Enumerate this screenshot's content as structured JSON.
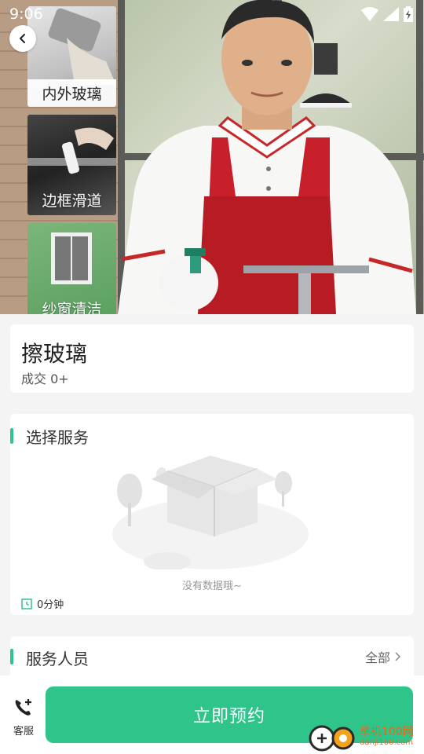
{
  "status_bar": {
    "time": "9:06"
  },
  "hero": {
    "thumbnails": [
      {
        "label": "内外玻璃"
      },
      {
        "label": "边框滑道"
      },
      {
        "label": "纱窗清洁"
      }
    ]
  },
  "service": {
    "title": "擦玻璃",
    "sales": "成交 0+"
  },
  "select_service": {
    "title": "选择服务",
    "empty_text": "没有数据哦~",
    "duration": "0分钟"
  },
  "staff": {
    "title": "服务人员",
    "all_label": "全部"
  },
  "bottom_bar": {
    "customer_service_label": "客服",
    "book_label": "立即预约"
  },
  "watermark": {
    "brand": "单机100网",
    "url": "danji100.com"
  },
  "colors": {
    "accent": "#2ec48a",
    "watermark": "#e86a1a"
  },
  "icons": [
    "wifi-icon",
    "signal-icon",
    "battery-icon",
    "back-arrow-icon",
    "clock-icon",
    "chevron-right-icon",
    "phone-add-icon"
  ]
}
